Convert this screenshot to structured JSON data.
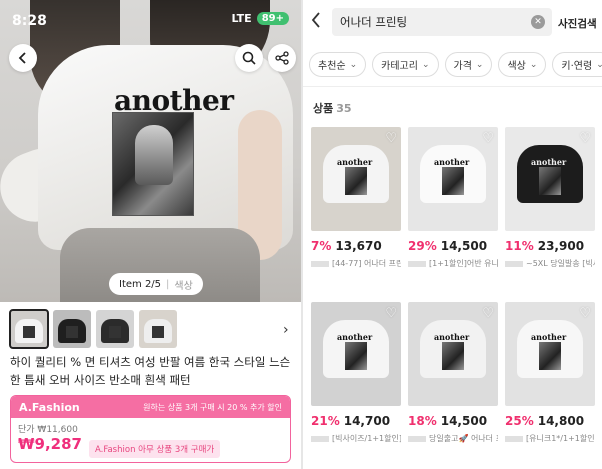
{
  "status_bar": {
    "time": "8:28",
    "network": "LTE",
    "battery": "89+"
  },
  "detail": {
    "item_counter": "Item 2/5",
    "color_label": "색상",
    "title": "하이 퀄리티 % 면 티셔츠 여성 반팔 여름 한국 스타일 느슨한 틈새 오버 사이즈 반소매 흰색 패턴",
    "print_word": "another",
    "deal": {
      "brand": "A.Fashion",
      "note": "원하는 상품 3개 구매 시 20 % 추가 할인",
      "unit_price": "단가 ₩11,600",
      "price": "₩9,287",
      "tag": "A.Fashion 아무 상품 3개 구매가"
    },
    "thumbs": [
      {
        "bg": "#cfcdca",
        "shirt": "#f3f3f3"
      },
      {
        "bg": "#bcbcbc",
        "shirt": "#1f1f1f"
      },
      {
        "bg": "#d4d4d4",
        "shirt": "#2b2b2b"
      },
      {
        "bg": "#d8d3cc",
        "shirt": "#eeeeee"
      }
    ]
  },
  "search": {
    "query": "어나더 프린팅",
    "photo_search_label": "사진검색",
    "filters": [
      {
        "label": "추천순"
      },
      {
        "label": "카테고리"
      },
      {
        "label": "가격"
      },
      {
        "label": "색상"
      },
      {
        "label": "키·연령"
      }
    ],
    "count_label": "상품",
    "count": "35",
    "products": [
      {
        "discount": "7%",
        "price": "13,670",
        "name": "[44-77] 어나더 프린팅",
        "bg": "#d7d3cc",
        "shirt": "#f4f4f4"
      },
      {
        "discount": "29%",
        "price": "14,500",
        "name": "[1+1할인]어반 유니크]",
        "bg": "#e6e6e6",
        "shirt": "#fafafa"
      },
      {
        "discount": "11%",
        "price": "23,900",
        "name": "~5XL 당일발송 [빅사",
        "bg": "#e9e9e9",
        "shirt": "#1c1c1c"
      },
      {
        "discount": "21%",
        "price": "14,700",
        "name": "[빅사이즈/1+1할인]",
        "bg": "#d2d2d2",
        "shirt": "#f5f5f5"
      },
      {
        "discount": "18%",
        "price": "14,500",
        "name": "당일출고🚀 어나더 프린",
        "bg": "#dcdcdc",
        "shirt": "#f2f2f2"
      },
      {
        "discount": "25%",
        "price": "14,800",
        "name": "[유니크1*/1+1할인]",
        "bg": "#e2e2e2",
        "shirt": "#f7f7f7"
      }
    ]
  }
}
